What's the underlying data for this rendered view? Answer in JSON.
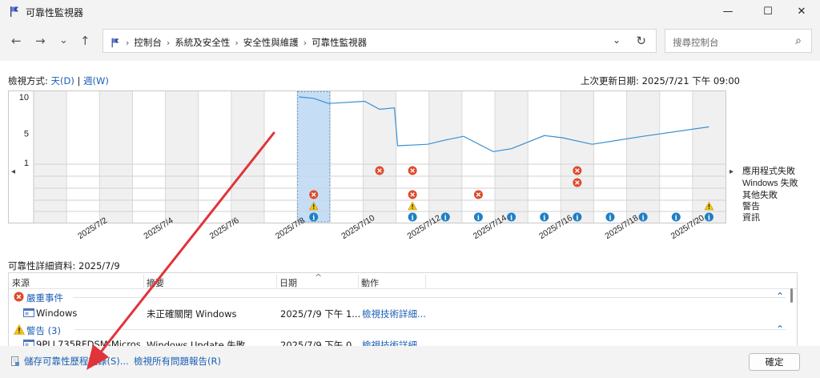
{
  "window": {
    "title": "可靠性監視器",
    "minimize": "—",
    "maximize": "☐",
    "close": "✕"
  },
  "nav": {
    "back": "←",
    "forward": "→",
    "recent": "⌄",
    "up": "↑"
  },
  "address": {
    "crumbs": [
      "控制台",
      "系統及安全性",
      "安全性與維護",
      "可靠性監視器"
    ],
    "dropdown": "⌄",
    "refresh": "↻"
  },
  "search": {
    "placeholder": "搜尋控制台",
    "icon": "⌕"
  },
  "view": {
    "label": "檢視方式: ",
    "day": "天(D)",
    "separator": " | ",
    "week": "週(W)"
  },
  "last_update": "上次更新日期: 2025/7/21 下午 09:00",
  "chart_data": {
    "type": "line",
    "y_ticks": [
      "10",
      "5",
      "1"
    ],
    "ylim": [
      1,
      10
    ],
    "x": [
      "2025/7/1",
      "2025/7/2",
      "2025/7/3",
      "2025/7/4",
      "2025/7/5",
      "2025/7/6",
      "2025/7/7",
      "2025/7/8",
      "2025/7/9",
      "2025/7/10",
      "2025/7/11",
      "2025/7/12",
      "2025/7/13",
      "2025/7/14",
      "2025/7/15",
      "2025/7/16",
      "2025/7/17",
      "2025/7/18",
      "2025/7/19",
      "2025/7/20",
      "2025/7/21"
    ],
    "x_tick_labels": [
      "2025/7/2",
      "2025/7/4",
      "2025/7/6",
      "2025/7/8",
      "2025/7/10",
      "2025/7/12",
      "2025/7/14",
      "2025/7/16",
      "2025/7/18",
      "2025/7/20"
    ],
    "stability_index": [
      [
        "2025/7/9",
        10.0
      ],
      [
        "2025/7/9",
        9.8
      ],
      [
        "2025/7/9",
        9.1
      ],
      [
        "2025/7/11",
        9.4
      ],
      [
        "2025/7/11",
        8.3
      ],
      [
        "2025/7/11",
        8.5
      ],
      [
        "2025/7/12",
        3.3
      ],
      [
        "2025/7/12",
        3.5
      ],
      [
        "2025/7/13",
        4.1
      ],
      [
        "2025/7/14",
        4.6
      ],
      [
        "2025/7/14",
        2.5
      ],
      [
        "2025/7/15",
        2.9
      ],
      [
        "2025/7/16",
        4.7
      ],
      [
        "2025/7/17",
        4.4
      ],
      [
        "2025/7/17",
        3.5
      ],
      [
        "2025/7/19",
        4.6
      ],
      [
        "2025/7/21",
        5.9
      ]
    ],
    "selected_date": "2025/7/9",
    "row_labels": [
      "應用程式失敗",
      "Windows 失敗",
      "其他失敗",
      "警告",
      "資訊"
    ],
    "events": [
      {
        "row": 0,
        "dates": [
          "2025/7/11",
          "2025/7/12",
          "2025/7/17"
        ]
      },
      {
        "row": 1,
        "dates": [
          "2025/7/17"
        ]
      },
      {
        "row": 2,
        "dates": [
          "2025/7/9",
          "2025/7/12",
          "2025/7/14"
        ]
      },
      {
        "row": 3,
        "dates": [
          "2025/7/9",
          "2025/7/12",
          "2025/7/21"
        ]
      },
      {
        "row": 4,
        "dates": [
          "2025/7/9",
          "2025/7/12",
          "2025/7/13",
          "2025/7/14",
          "2025/7/15",
          "2025/7/16",
          "2025/7/17",
          "2025/7/18",
          "2025/7/19",
          "2025/7/20",
          "2025/7/21"
        ]
      }
    ],
    "scroll_left": "◂",
    "scroll_right": "▸"
  },
  "details": {
    "title": "可靠性詳細資料: 2025/7/9",
    "columns": [
      "來源",
      "摘要",
      "日期",
      "動作"
    ],
    "sort_indicator": "^",
    "groups": [
      {
        "title": "嚴重事件",
        "rows": [
          {
            "source": "Windows",
            "summary": "未正確關閉 Windows",
            "date": "2025/7/9 下午 1...",
            "action": "檢視技術詳細..."
          }
        ]
      },
      {
        "title": "警告 (3)",
        "rows": [
          {
            "source": "9PLL735RFDSM-Micros...",
            "summary": "Windows Update 失敗",
            "date": "2025/7/9 下午 0...",
            "action": "檢視技術詳細..."
          }
        ]
      }
    ]
  },
  "footer": {
    "save": "儲存可靠性歷程記錄(S)...",
    "view_all": "檢視所有問題報告(R)",
    "ok": "確定"
  },
  "colors": {
    "accent": "#1a5fb4",
    "line": "#3a8fd0",
    "error": "#e0492a",
    "warning": "#f3c318",
    "info": "#1e7fc4",
    "annotation": "#e0343a"
  }
}
